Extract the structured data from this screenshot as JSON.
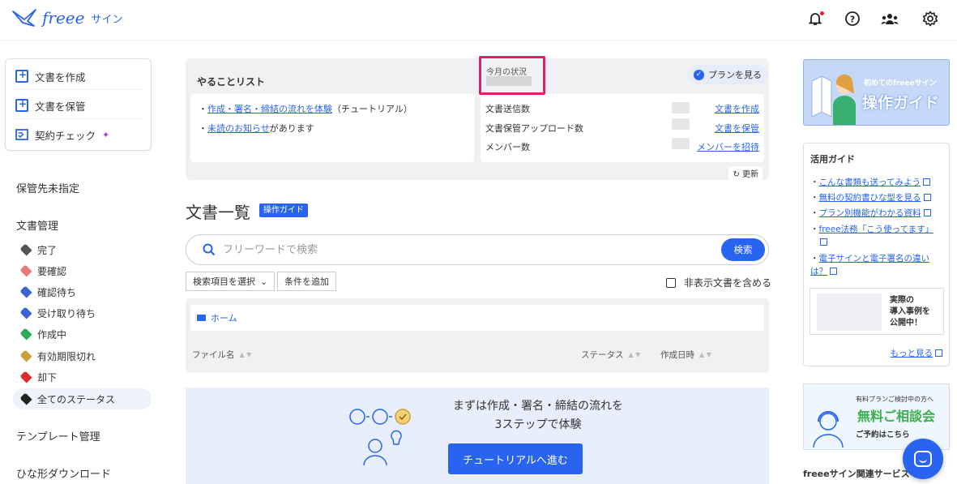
{
  "header": {
    "logo_word": "freee",
    "logo_product": "サイン",
    "icons": [
      "bell-icon",
      "help-icon",
      "members-icon",
      "gear-icon"
    ]
  },
  "sidebar": {
    "create_menu": [
      {
        "label": "文書を作成",
        "icon": "new-document-icon"
      },
      {
        "label": "文書を保管",
        "icon": "store-document-icon"
      },
      {
        "label": "契約チェック",
        "icon": "contract-check-icon"
      }
    ],
    "storage_unspecified": "保管先未指定",
    "doc_management": "文書管理",
    "statuses": [
      {
        "label": "完了",
        "color": "#555555"
      },
      {
        "label": "要確認",
        "color": "#e87a7a"
      },
      {
        "label": "確認待ち",
        "color": "#3a63d6"
      },
      {
        "label": "受け取り待ち",
        "color": "#3a63d6"
      },
      {
        "label": "作成中",
        "color": "#2eaa57"
      },
      {
        "label": "有効期限切れ",
        "color": "#c9a03a"
      },
      {
        "label": "却下",
        "color": "#d92c2c"
      },
      {
        "label": "全てのステータス",
        "color": "#222222"
      }
    ],
    "template_management": "テンプレート管理",
    "template_download": "ひな形ダウンロード"
  },
  "todo": {
    "title": "やることリスト",
    "item1_link": "作成・署名・締結の流れを体験",
    "item1_suffix": "（チュートリアル）",
    "item2_link": "未読のお知らせ",
    "item2_suffix": "があります"
  },
  "month_status": {
    "title": "今月の状況",
    "plan_button": "プランを見る",
    "rows": [
      {
        "label": "文書送信数",
        "link": "文書を作成"
      },
      {
        "label": "文書保管アップロード数",
        "link": "文書を保管"
      },
      {
        "label": "メンバー数",
        "link": "メンバーを招待"
      }
    ],
    "refresh": "更新"
  },
  "documents": {
    "title": "文書一覧",
    "guide_badge": "操作ガイド",
    "search_placeholder": "フリーワードで検索",
    "search_button": "検索",
    "select_items": "検索項目を選択",
    "add_condition": "条件を追加",
    "include_hidden": "非表示文書を含める",
    "home": "ホーム",
    "col_filename": "ファイル名",
    "col_status": "ステータス",
    "col_created": "作成日時"
  },
  "tutorial": {
    "line1": "まずは作成・署名・締結の流れを",
    "line2": "3ステップで体験",
    "button": "チュートリアルへ進む"
  },
  "right": {
    "guide_small": "初めてのfreeeサイン",
    "guide_big": "操作ガイド",
    "katsuyou_title": "活用ガイド",
    "links": [
      "こんな書類も送ってみよう",
      "無料の契約書ひな型を見る",
      "プラン別機能がわかる資料",
      "freee法務「こう使ってます」",
      "電子サインと電子署名の違いは？"
    ],
    "case_line1": "実際の",
    "case_line2": "導入事例を",
    "case_line3": "公開中！",
    "more": "もっと見る",
    "consult_small": "有料プランご検討中の方へ",
    "consult_big": "無料ご相談会",
    "consult_sub": "ご予約はこちら",
    "related": "freeeサイン関連サービス"
  },
  "colors": {
    "accent": "#2864f0",
    "highlight": "#e0206a"
  }
}
